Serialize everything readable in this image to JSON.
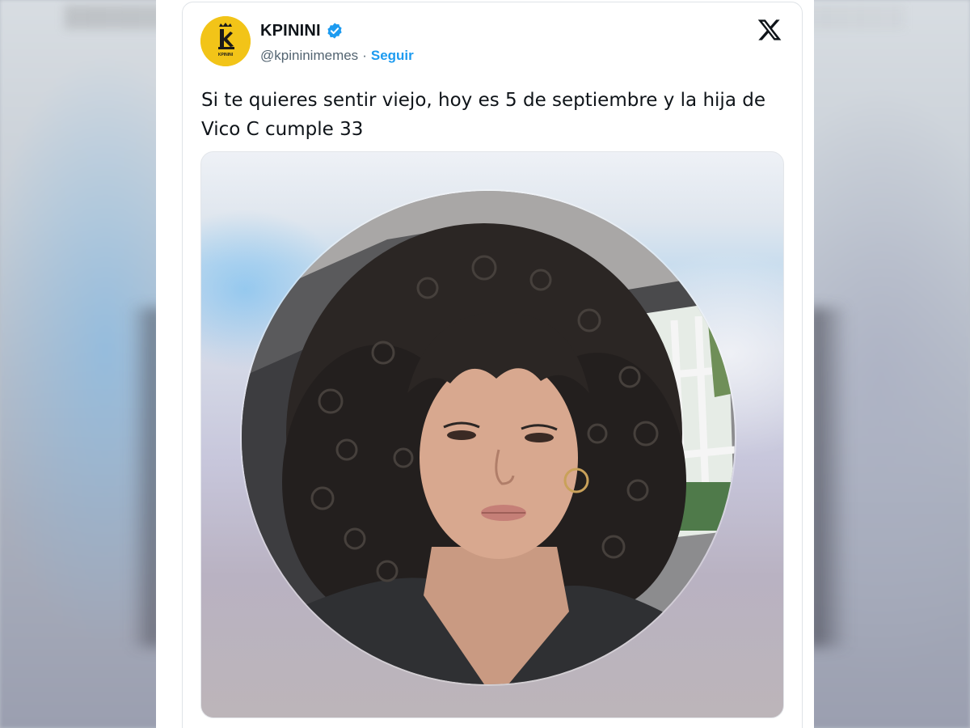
{
  "tweet": {
    "display_name": "KPININI",
    "handle": "@kpininimemes",
    "separator": "·",
    "follow_label": "Seguir",
    "text": "Si te quieres sentir viejo, hoy es 5 de septiembre y la hija de Vico C cumple 33",
    "avatar_text": "KPININI"
  },
  "icons": {
    "verified": "verified-badge-icon",
    "platform": "x-logo-icon"
  },
  "colors": {
    "link_blue": "#1d9bf0",
    "verified_blue": "#1d9bf0",
    "avatar_yellow": "#f2c418",
    "text_primary": "#0f1419",
    "text_secondary": "#536471"
  }
}
